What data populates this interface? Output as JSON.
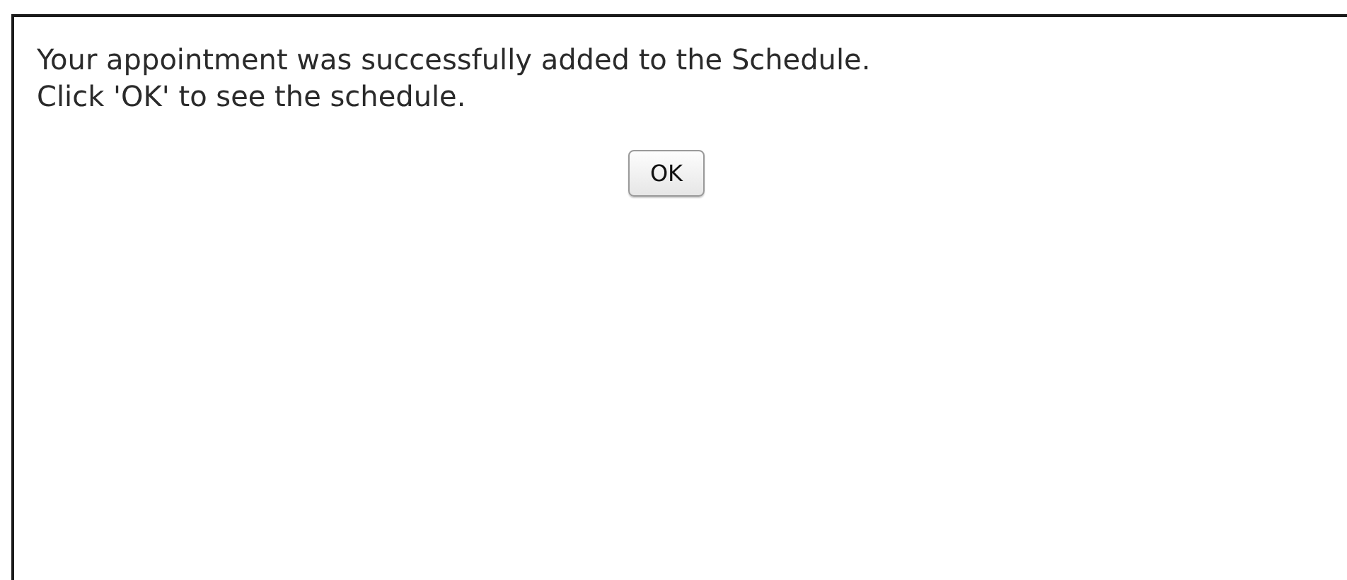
{
  "message_lines": [
    "Your appointment was successfully added to the Schedule.",
    "Click 'OK' to see the schedule."
  ],
  "buttons": [
    "OK"
  ]
}
